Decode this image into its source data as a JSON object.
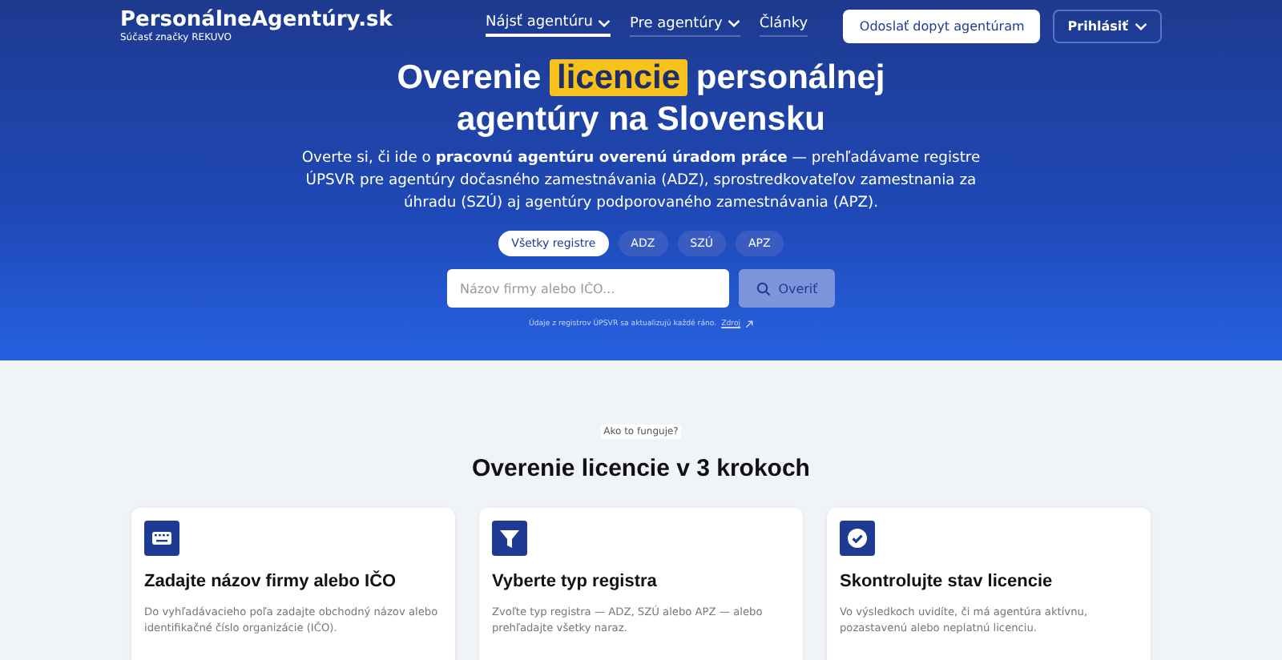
{
  "header": {
    "logo": "PersonálneAgentúry.sk",
    "tagline": "Súčasť značky REKUVO",
    "nav": [
      {
        "label": "Nájsť agentúru",
        "selected": true,
        "dropdown": true
      },
      {
        "label": "Pre agentúry",
        "selected": false,
        "dropdown": true
      },
      {
        "label": "Články",
        "selected": false,
        "dropdown": false
      }
    ],
    "cta": "Odoslať dopyt agentúram",
    "login": "Prihlásiť"
  },
  "hero": {
    "title_before": "Overenie",
    "title_highlight": "licencie",
    "title_after": "personálnej agentúry na Slovensku",
    "intro": "Overte si, či ide o **pracovnú agentúru overenú úradom práce** — prehľadávame registre ÚPSVR pre agentúry dočasného zamestnávania (ADZ), sprostredkovateľov zamestnania za úhradu (SZÚ) aj agentúry podporovaného zamestnávania (APZ).",
    "filters": [
      {
        "label": "Všetky registre",
        "selected": true
      },
      {
        "label": "ADZ",
        "selected": false
      },
      {
        "label": "SZÚ",
        "selected": false
      },
      {
        "label": "APZ",
        "selected": false
      }
    ],
    "search": {
      "placeholder": "Názov firmy alebo IČO..."
    },
    "search_button": "Overiť",
    "note": "Údaje z registrov ÚPSVR sa aktualizujú každé ráno.",
    "note_link": "Zdroj"
  },
  "steps": {
    "eyebrow": "Ako to funguje?",
    "title": "Overenie licencie v 3 krokoch",
    "cards": [
      {
        "kind": "keyboard",
        "title": "Zadajte názov firmy alebo IČO",
        "text": "Do vyhľadávacieho poľa zadajte obchodný názov alebo identifikačné číslo organizácie (IČO)."
      },
      {
        "kind": "filter",
        "title": "Vyberte typ registra",
        "text": "Zvoľte typ registra — ADZ, SZÚ alebo APZ — alebo prehľadajte všetky naraz."
      },
      {
        "kind": "check",
        "title": "Skontrolujte stav licencie",
        "text": "Vo výsledkoch uvidíte, či má agentúra aktívnu, pozastavenú alebo neplatnú licenciu."
      }
    ]
  }
}
